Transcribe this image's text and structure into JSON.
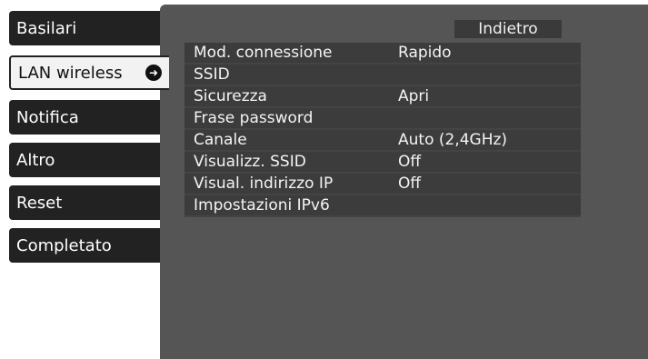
{
  "sidebar": {
    "items": [
      {
        "label": "Basilari",
        "active": false
      },
      {
        "label": "LAN wireless",
        "active": true
      },
      {
        "label": "Notifica",
        "active": false
      },
      {
        "label": "Altro",
        "active": false
      },
      {
        "label": "Reset",
        "active": false
      },
      {
        "label": "Completato",
        "active": false
      }
    ]
  },
  "panel": {
    "back_label": "Indietro",
    "rows": [
      {
        "label": "Mod. connessione",
        "value": "Rapido"
      },
      {
        "label": "SSID",
        "value": ""
      },
      {
        "label": "Sicurezza",
        "value": "Apri"
      },
      {
        "label": "Frase password",
        "value": ""
      },
      {
        "label": "Canale",
        "value": "Auto (2,4GHz)"
      },
      {
        "label": "Visualizz. SSID",
        "value": "Off"
      },
      {
        "label": "Visual. indirizzo IP",
        "value": "Off"
      },
      {
        "label": "Impostazioni IPv6",
        "value": ""
      }
    ]
  },
  "colors": {
    "panel_bg": "#555555",
    "row_bg": "#3c3c3c",
    "sidebar_bg": "#222222",
    "active_bg": "#f2f2f2"
  },
  "icons": {
    "active_indicator": "chevron-right-icon"
  }
}
